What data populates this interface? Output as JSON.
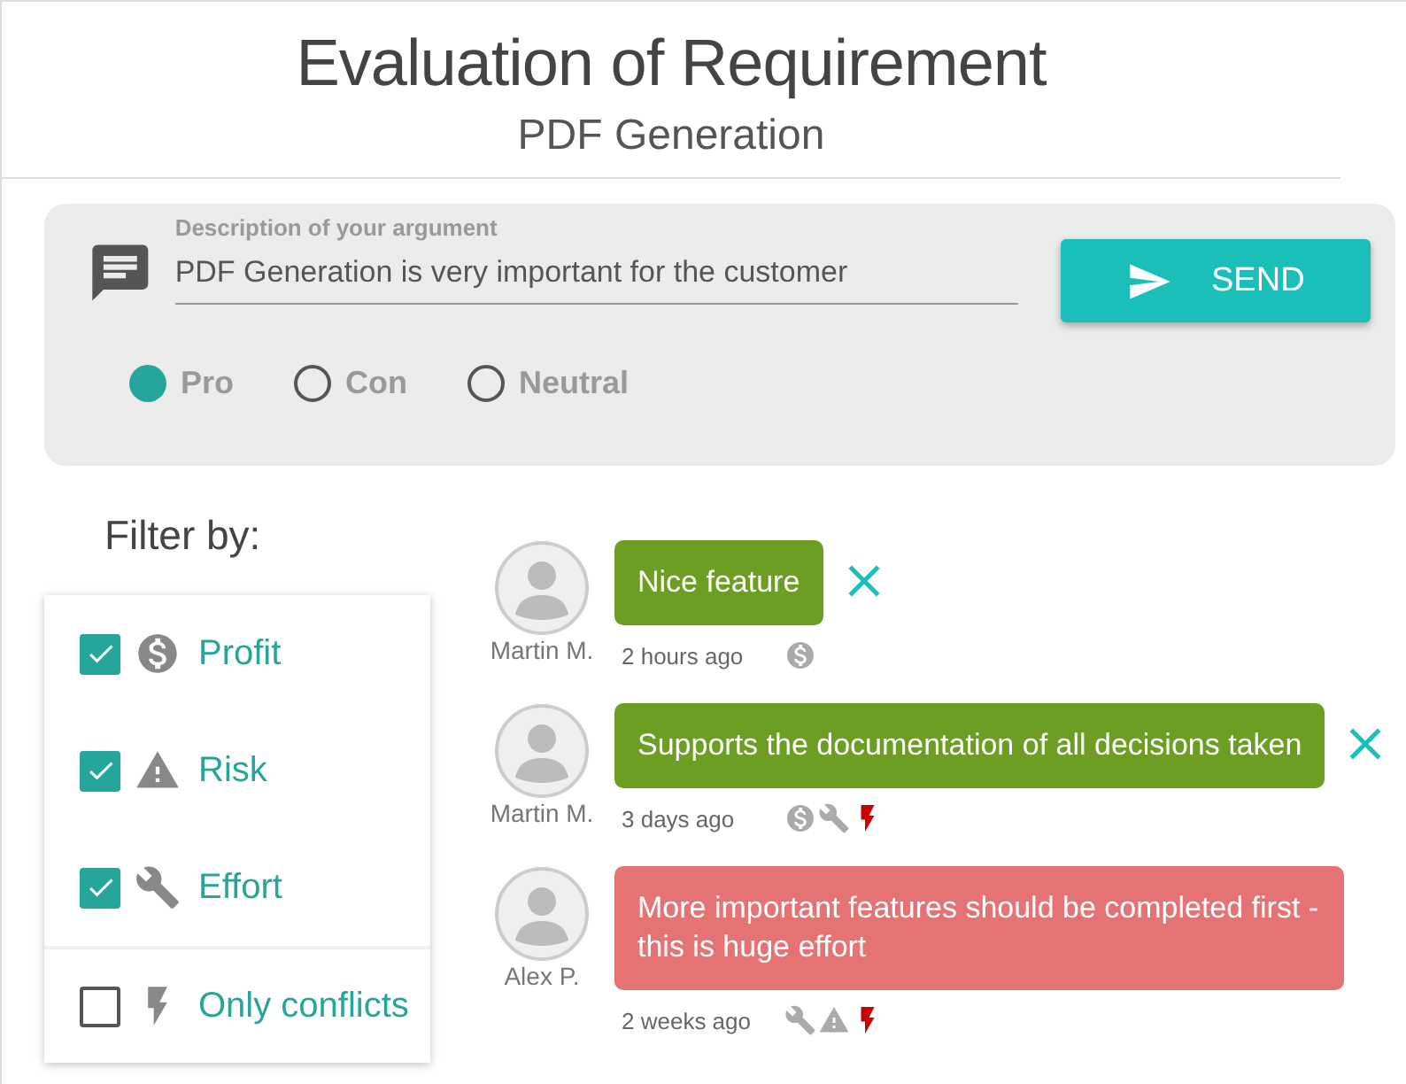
{
  "header": {
    "title": "Evaluation of Requirement",
    "subtitle": "PDF Generation"
  },
  "argument_form": {
    "label": "Description of your argument",
    "value": "PDF Generation is very important for the customer",
    "send_button": "SEND",
    "stances": [
      {
        "label": "Pro",
        "selected": true
      },
      {
        "label": "Con",
        "selected": false
      },
      {
        "label": "Neutral",
        "selected": false
      }
    ]
  },
  "filter": {
    "title": "Filter by:",
    "items": [
      {
        "kind": "profit",
        "label": "Profit",
        "checked": true
      },
      {
        "kind": "risk",
        "label": "Risk",
        "checked": true
      },
      {
        "kind": "effort",
        "label": "Effort",
        "checked": true
      },
      {
        "kind": "conflict",
        "label": "Only conflicts",
        "checked": false
      }
    ]
  },
  "comments": [
    {
      "author": "Martin M.",
      "text": "Nice feature",
      "time": "2 hours ago",
      "kind": "pro",
      "removable": true,
      "tags": [
        {
          "kind": "profit"
        }
      ]
    },
    {
      "author": "Martin M.",
      "text": "Supports the documentation of all decisions taken",
      "time": "3 days ago",
      "kind": "pro",
      "removable": true,
      "tags": [
        {
          "kind": "profit"
        },
        {
          "kind": "effort"
        },
        {
          "kind": "conflict"
        }
      ]
    },
    {
      "author": "Alex P.",
      "text": "More important features should be completed first - this is huge effort",
      "time": "2 weeks ago",
      "kind": "con",
      "removable": false,
      "tags": [
        {
          "kind": "effort"
        },
        {
          "kind": "risk"
        },
        {
          "kind": "conflict"
        }
      ]
    }
  ]
}
